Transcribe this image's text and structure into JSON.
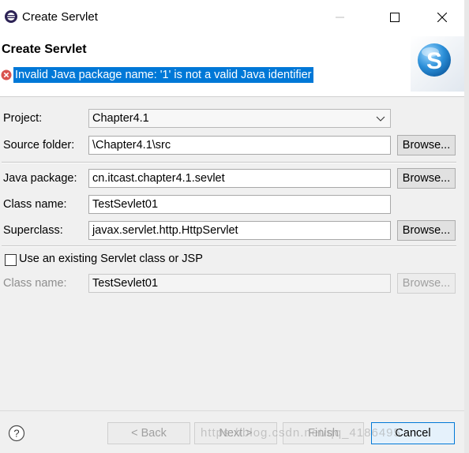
{
  "window": {
    "title": "Create Servlet"
  },
  "header": {
    "heading": "Create Servlet",
    "error_message": "Invalid Java package name: '1' is not a valid Java identifier"
  },
  "form": {
    "project": {
      "label": "Project:",
      "value": "Chapter4.1"
    },
    "source_folder": {
      "label": "Source folder:",
      "value": "\\Chapter4.1\\src",
      "button": "Browse..."
    },
    "java_package": {
      "label": "Java package:",
      "value": "cn.itcast.chapter4.1.sevlet",
      "button": "Browse..."
    },
    "class_name": {
      "label": "Class name:",
      "value": "TestSevlet01"
    },
    "superclass": {
      "label": "Superclass:",
      "value": "javax.servlet.http.HttpServlet",
      "button": "Browse..."
    },
    "use_existing": {
      "label": "Use an existing Servlet class or JSP",
      "checked": false
    },
    "existing_class_name": {
      "label": "Class name:",
      "value": "TestSevlet01",
      "button": "Browse..."
    }
  },
  "footer": {
    "back": "< Back",
    "next": "Next >",
    "finish": "Finish",
    "cancel": "Cancel",
    "watermark": "https://blog.csdn.net/qq_4186495"
  },
  "colors": {
    "selection": "#0078d7",
    "error": "#d9534f"
  }
}
